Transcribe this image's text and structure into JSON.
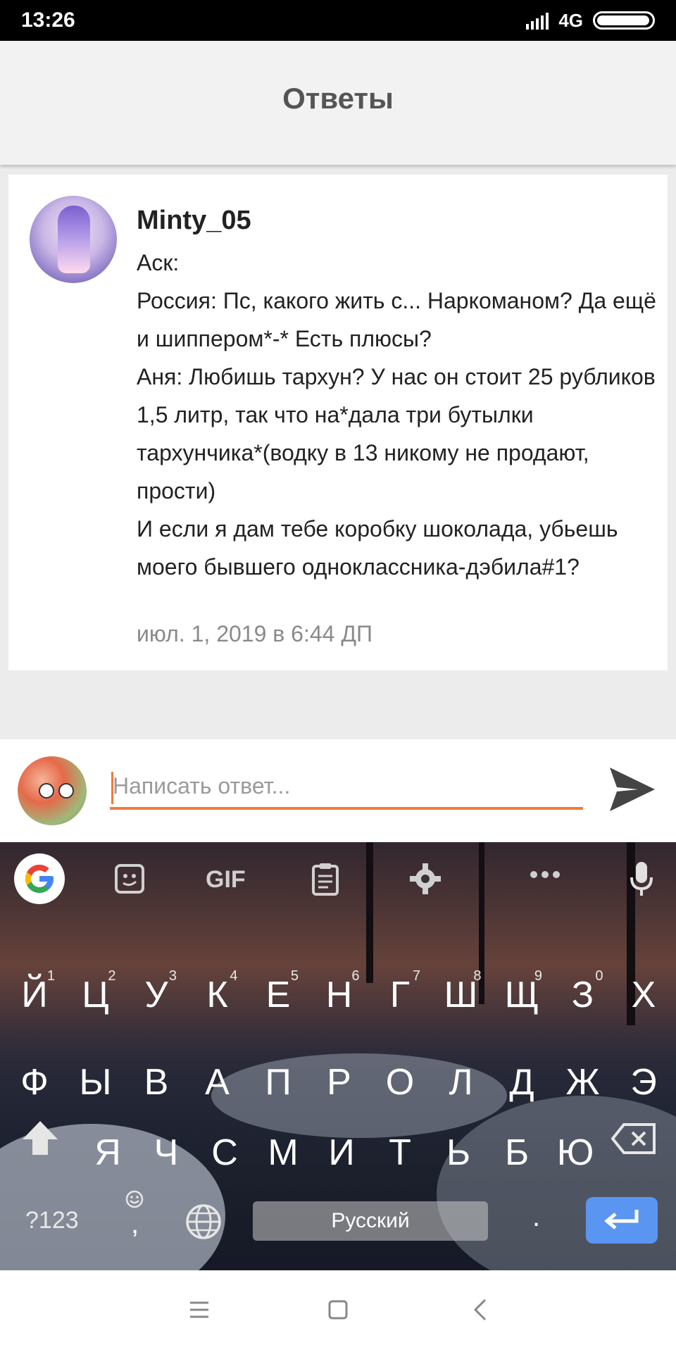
{
  "status_bar": {
    "time": "13:26",
    "network": "4G"
  },
  "header": {
    "title": "Ответы"
  },
  "answer": {
    "username": "Minty_05",
    "lines": [
      "Аск:",
      "Россия: Пс, какого жить с... Наркоманом? Да ещё и шиппером*-* Есть плюсы?",
      "Аня: Любишь тархун? У нас он стоит 25 рубликов 1,5 литр, так что на*дала три бутылки тархунчика*(водку в 13 никому не продают, прости)",
      "И если я дам тебе коробку шоколада, убьешь моего бывшего одноклассника-дэбила#1?"
    ],
    "timestamp": "июл. 1, 2019 в 6:44 ДП"
  },
  "reply": {
    "placeholder": "Написать ответ..."
  },
  "keyboard": {
    "toolbar": {
      "gif_label": "GIF"
    },
    "row1": [
      "Й",
      "Ц",
      "У",
      "К",
      "Е",
      "Н",
      "Г",
      "Ш",
      "Щ",
      "З",
      "Х"
    ],
    "row1_hints": [
      "1",
      "2",
      "3",
      "4",
      "5",
      "6",
      "7",
      "8",
      "9",
      "0",
      ""
    ],
    "row2": [
      "Ф",
      "Ы",
      "В",
      "А",
      "П",
      "Р",
      "О",
      "Л",
      "Д",
      "Ж",
      "Э"
    ],
    "row3": [
      "Я",
      "Ч",
      "С",
      "М",
      "И",
      "Т",
      "Ь",
      "Б",
      "Ю"
    ],
    "symbols_label": "?123",
    "comma": ",",
    "space_label": "Русский",
    "period": "."
  },
  "colors": {
    "accent": "#f27a3b",
    "enter_key": "#5b95f2",
    "header_bg": "#f2f2f2"
  }
}
